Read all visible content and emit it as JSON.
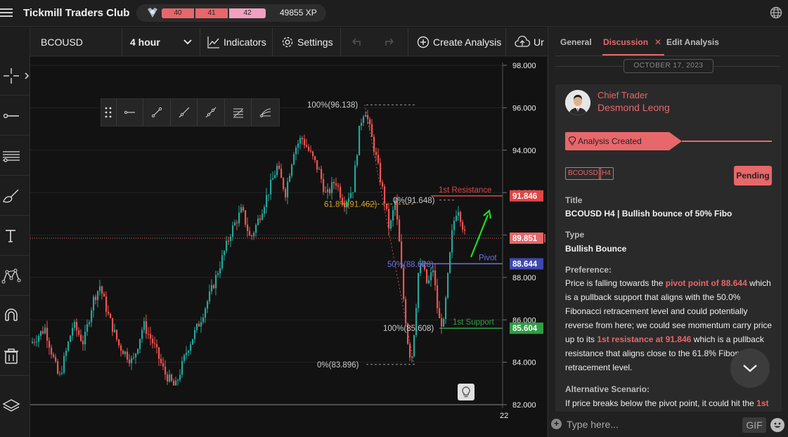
{
  "app": {
    "title": "Tickmill Traders Club",
    "xp": {
      "seg1": "40",
      "seg2": "41",
      "seg3": "42",
      "value": "49855 XP"
    }
  },
  "toolbar": {
    "symbol": "BCOUSD",
    "timeframe": "4 hour",
    "indicators": "Indicators",
    "settings": "Settings",
    "create_analysis": "Create Analysis",
    "upload": "Ur"
  },
  "chart_data": {
    "type": "candlestick",
    "symbol": "BCOUSD",
    "timeframe": "4 hour",
    "y_ticks": [
      "98.000",
      "96.000",
      "94.000",
      "92.000",
      "90.000",
      "88.000",
      "86.000",
      "84.000",
      "82.000"
    ],
    "ylim": [
      82,
      98
    ],
    "x_ticks": [
      "22"
    ],
    "last_price": "89.851",
    "price_labels": [
      {
        "text": "91.846",
        "value": 91.846,
        "color": "#e04646"
      },
      {
        "text": "89.851",
        "value": 89.851,
        "color": "#e8676a"
      },
      {
        "text": "88.644",
        "value": 88.644,
        "color": "#3e49b0"
      },
      {
        "text": "85.604",
        "value": 85.604,
        "color": "#2f9e44"
      }
    ],
    "fib_primary": [
      {
        "text": "100%(96.138)",
        "value": 96.138
      },
      {
        "text": "61.8%(91.462)",
        "value": 91.462
      },
      {
        "text": "0%(83.896)",
        "value": 83.896
      }
    ],
    "fib_secondary": [
      {
        "text": "0%(91.648)",
        "value": 91.648
      },
      {
        "text": "50%(88.628)",
        "value": 88.628
      },
      {
        "text": "100%(85.608)",
        "value": 85.608
      }
    ],
    "levels": [
      {
        "name": "1st Resistance",
        "value": 91.846,
        "color": "#e04646"
      },
      {
        "name": "Pivot",
        "value": 88.644,
        "color": "#6a72e0"
      },
      {
        "name": "1st Support",
        "value": 85.604,
        "color": "#2f9e44"
      }
    ],
    "bull_color": "#26a69a",
    "bear_color": "#ef5350"
  },
  "panel": {
    "tabs": [
      "General",
      "Discussion",
      "Edit Analysis"
    ],
    "active_tab": "Discussion",
    "date": "OCTOBER 17, 2023",
    "post": {
      "role": "Chief Trader",
      "author": "Desmond Leong",
      "status_banner": "Analysis Created",
      "tags": [
        "BCOUSD",
        "H4"
      ],
      "badge": "Pending",
      "title_label": "Title",
      "title": "BCOUSD H4 | Bullish bounce of 50% Fibo",
      "type_label": "Type",
      "type": "Bullish Bounce",
      "preference_label": "Preference:",
      "preference": {
        "p1": "Price is falling towards the ",
        "h1": "pivot point of 88.644",
        "p2": " which is a pullback support that aligns with the 50.0% Fibonacci retracement level and could potentially reverse from here; we could see momentum carry price up to its ",
        "h2": "1st resistance at 91.846",
        "p3": " which is a pullback resistance that aligns close to the 61.8% Fibonacci retracement level."
      },
      "alt_label": "Alternative Scenario:",
      "alt": {
        "p1": "If price breaks below the pivot point, it could hit the ",
        "h1": "1st"
      }
    },
    "chat_placeholder": "Type here...",
    "gif_label": "GIF"
  }
}
